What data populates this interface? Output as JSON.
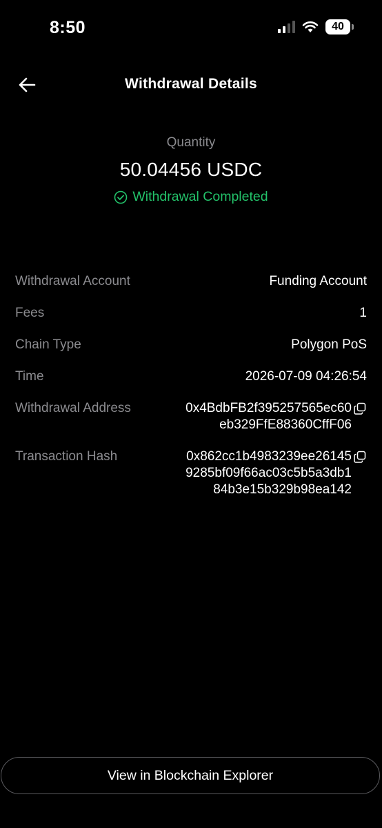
{
  "status_bar": {
    "time": "8:50",
    "battery_level": "40",
    "icons": [
      "signal-icon",
      "wifi-icon",
      "battery-icon"
    ]
  },
  "header": {
    "back_icon": "arrow-left-icon",
    "title": "Withdrawal Details"
  },
  "summary": {
    "quantity_label": "Quantity",
    "quantity_value": "50.04456 USDC",
    "status_icon": "check-circle-icon",
    "status_text": "Withdrawal Completed"
  },
  "details": [
    {
      "label": "Withdrawal Account",
      "value": "Funding Account"
    },
    {
      "label": "Fees",
      "value": "1"
    },
    {
      "label": "Chain Type",
      "value": "Polygon PoS"
    },
    {
      "label": "Time",
      "value": "2026-07-09 04:26:54"
    },
    {
      "label": "Withdrawal Address",
      "value_lines": [
        "0x4BdbFB2f395257565ec60",
        "eb329FfE88360CffF06"
      ],
      "copy_icon": "copy-icon"
    },
    {
      "label": "Transaction Hash",
      "value_lines": [
        "0x862cc1b4983239ee26145",
        "9285bf09f66ac03c5b5a3db1",
        "84b3e15b329b98ea142"
      ],
      "copy_icon": "copy-icon"
    }
  ],
  "footer": {
    "explorer_button_label": "View in Blockchain Explorer"
  },
  "colors": {
    "background": "#000000",
    "muted_text": "#8b8b8f",
    "success": "#23c26a",
    "button_border": "#5a5a5e"
  }
}
